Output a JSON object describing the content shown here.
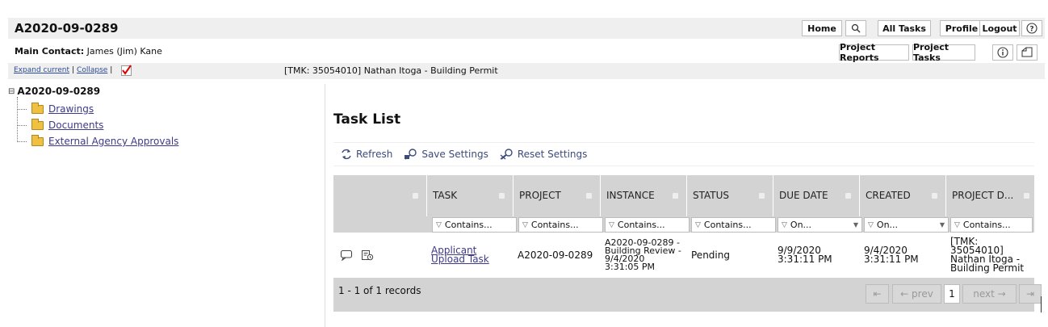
{
  "header": {
    "project_id": "A2020-09-0289",
    "nav": {
      "home": "Home",
      "all_tasks": "All Tasks",
      "profile": "Profile",
      "logout": "Logout"
    },
    "main_contact_label": "Main Contact:",
    "main_contact_value": "James (Jim) Kane",
    "project_reports": "Project Reports",
    "project_tasks": "Project Tasks",
    "expand_current": "Expand current",
    "collapse": "Collapse",
    "project_description": "[TMK: 35054010]  Nathan Itoga - Building Permit"
  },
  "tree": {
    "root": "A2020-09-0289",
    "items": [
      "Drawings",
      "Documents",
      "External Agency Approvals"
    ]
  },
  "task_panel": {
    "title": "Task List",
    "toolbar": {
      "refresh": "Refresh",
      "save_settings": "Save Settings",
      "reset_settings": "Reset Settings"
    },
    "columns": [
      "TASK",
      "PROJECT",
      "INSTANCE",
      "STATUS",
      "DUE DATE",
      "CREATED",
      "PROJECT D..."
    ],
    "filters": [
      "Contains...",
      "Contains...",
      "Contains...",
      "Contains...",
      "On...",
      "On...",
      "Contains..."
    ],
    "row": {
      "task": "Applicant Upload Task",
      "project": "A2020-09-0289",
      "instance": "A2020-09-0289 - Building Review - 9/4/2020 3:31:05 PM",
      "status": "Pending",
      "due_date": "9/9/2020 3:31:11 PM",
      "created": "9/4/2020 3:31:11 PM",
      "project_desc": "[TMK: 35054010] Nathan Itoga - Building Permit"
    },
    "records": "1 - 1 of 1 records",
    "pager": {
      "first": "⇤",
      "prev": "← prev",
      "page": "1",
      "next": "next →",
      "last": "⇥"
    }
  },
  "colors": {
    "accent_link": "#3d3a8a",
    "header_bg": "#efefef",
    "grid_header": "#d3d3d3"
  }
}
